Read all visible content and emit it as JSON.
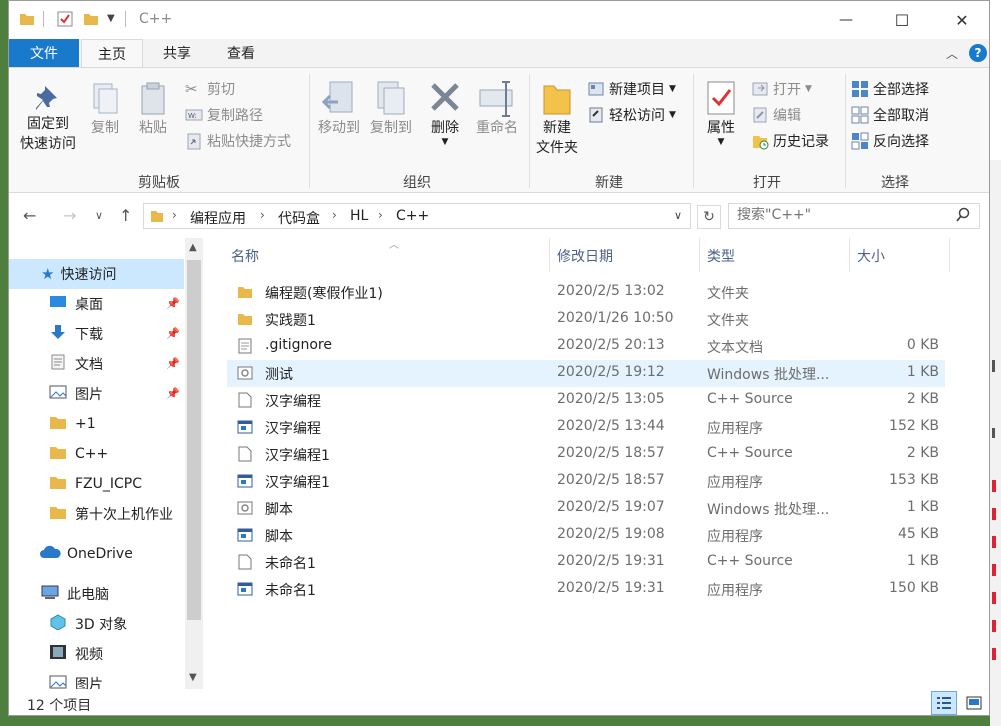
{
  "window": {
    "title": "C++"
  },
  "titlebar": {
    "minimize": "—",
    "maximize": "☐",
    "close": "✕"
  },
  "tabs": {
    "file": "文件",
    "home": "主页",
    "share": "共享",
    "view": "查看"
  },
  "ribbon": {
    "clipboard": {
      "label": "剪贴板",
      "pin": "固定到快速访问",
      "pin_line1": "固定到",
      "pin_line2": "快速访问",
      "copy": "复制",
      "paste": "粘贴",
      "cut": "剪切",
      "copy_path": "复制路径",
      "paste_shortcut": "粘贴快捷方式"
    },
    "organize": {
      "label": "组织",
      "move_to": "移动到",
      "copy_to": "复制到",
      "delete": "删除",
      "rename": "重命名"
    },
    "new": {
      "label": "新建",
      "new_folder_line1": "新建",
      "new_folder_line2": "文件夹",
      "new_item": "新建项目",
      "easy_access": "轻松访问"
    },
    "open": {
      "label": "打开",
      "properties": "属性",
      "open": "打开",
      "edit": "编辑",
      "history": "历史记录"
    },
    "select": {
      "label": "选择",
      "select_all": "全部选择",
      "select_none": "全部取消",
      "invert": "反向选择"
    }
  },
  "address": {
    "breadcrumbs": [
      "编程应用",
      "代码盒",
      "HL",
      "C++"
    ],
    "search_placeholder": "搜索\"C++\""
  },
  "nav": {
    "items": [
      {
        "label": "快速访问",
        "icon": "star-icon",
        "pinned": false
      },
      {
        "label": "桌面",
        "icon": "desktop-icon",
        "pinned": true
      },
      {
        "label": "下载",
        "icon": "download-icon",
        "pinned": true
      },
      {
        "label": "文档",
        "icon": "document-icon",
        "pinned": true
      },
      {
        "label": "图片",
        "icon": "picture-icon",
        "pinned": true
      },
      {
        "label": "+1",
        "icon": "folder-icon",
        "pinned": false
      },
      {
        "label": "C++",
        "icon": "folder-icon",
        "pinned": false
      },
      {
        "label": "FZU_ICPC",
        "icon": "folder-icon",
        "pinned": false
      },
      {
        "label": "第十次上机作业",
        "icon": "folder-icon",
        "pinned": false
      },
      {
        "label": "OneDrive",
        "icon": "cloud-icon",
        "pinned": false
      },
      {
        "label": "此电脑",
        "icon": "computer-icon",
        "pinned": false
      },
      {
        "label": "3D 对象",
        "icon": "cube-icon",
        "pinned": false
      },
      {
        "label": "视频",
        "icon": "video-icon",
        "pinned": false
      },
      {
        "label": "图片",
        "icon": "picture-icon",
        "pinned": false
      }
    ]
  },
  "columns": {
    "name": "名称",
    "date": "修改日期",
    "type": "类型",
    "size": "大小"
  },
  "files": [
    {
      "name": "编程题(寒假作业1)",
      "date": "2020/2/5 13:02",
      "type": "文件夹",
      "size": "",
      "icon": "folder-icon"
    },
    {
      "name": "实践题1",
      "date": "2020/1/26 10:50",
      "type": "文件夹",
      "size": "",
      "icon": "folder-icon"
    },
    {
      "name": ".gitignore",
      "date": "2020/2/5 20:13",
      "type": "文本文档",
      "size": "0 KB",
      "icon": "text-file-icon"
    },
    {
      "name": "测试",
      "date": "2020/2/5 19:12",
      "type": "Windows 批处理...",
      "size": "1 KB",
      "icon": "batch-file-icon"
    },
    {
      "name": "汉字编程",
      "date": "2020/2/5 13:05",
      "type": "C++ Source",
      "size": "2 KB",
      "icon": "cpp-file-icon"
    },
    {
      "name": "汉字编程",
      "date": "2020/2/5 13:44",
      "type": "应用程序",
      "size": "152 KB",
      "icon": "exe-file-icon"
    },
    {
      "name": "汉字编程1",
      "date": "2020/2/5 18:57",
      "type": "C++ Source",
      "size": "2 KB",
      "icon": "cpp-file-icon"
    },
    {
      "name": "汉字编程1",
      "date": "2020/2/5 18:57",
      "type": "应用程序",
      "size": "153 KB",
      "icon": "exe-file-icon"
    },
    {
      "name": "脚本",
      "date": "2020/2/5 19:07",
      "type": "Windows 批处理...",
      "size": "1 KB",
      "icon": "batch-file-icon"
    },
    {
      "name": "脚本",
      "date": "2020/2/5 19:08",
      "type": "应用程序",
      "size": "45 KB",
      "icon": "exe-file-icon"
    },
    {
      "name": "未命名1",
      "date": "2020/2/5 19:31",
      "type": "C++ Source",
      "size": "1 KB",
      "icon": "cpp-file-icon"
    },
    {
      "name": "未命名1",
      "date": "2020/2/5 19:31",
      "type": "应用程序",
      "size": "150 KB",
      "icon": "exe-file-icon"
    }
  ],
  "status": {
    "count": "12 个项目"
  },
  "colors": {
    "accent": "#1979ca",
    "selected": "#cce8ff",
    "hover": "#e5f3ff",
    "folder": "#e8b84a"
  }
}
